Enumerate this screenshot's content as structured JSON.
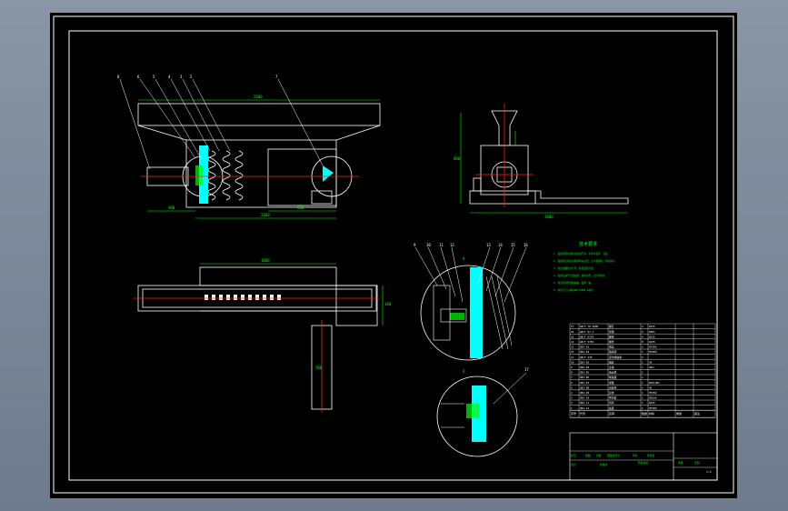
{
  "colors": {
    "background": "#000000",
    "frame": "#ffffff",
    "centerline": "#ff2020",
    "highlight": "#00ffff",
    "dimension": "#00ff00",
    "outline": "#ffffff"
  },
  "main_view": {
    "part_callouts": [
      "8",
      "6",
      "5",
      "4",
      "3",
      "2",
      "7"
    ],
    "dim_top": "2280",
    "dim_bottom_left": "480",
    "dim_bottom_mid": "2260",
    "dim_bottom_right": "600"
  },
  "plan_view": {
    "dim_top": "1000",
    "dim_right": "140",
    "dim_column": "780"
  },
  "side_view": {
    "dim_left": "800",
    "dim_bottom": "1800"
  },
  "detail_view": {
    "callouts": [
      "9",
      "10",
      "11",
      "12",
      "13",
      "14",
      "15",
      "16"
    ],
    "section_label_top": "A",
    "section_label_bottom": "A",
    "lower_callout": "17"
  },
  "tech_notes": {
    "title": "技术要求",
    "lines": [
      "1. 装配前所有零件应清洗干净，不得有毛刺、飞边。",
      "2. 装配时应保证各轴承转动灵活，无卡滞现象，润滑良好。",
      "3. 各连接螺栓应拧紧，防松装置可靠。",
      "4. 装配后进行空载试验，运转平稳，无异常噪音。",
      "5. 外表面涂防锈漆两遍，面漆一遍。",
      "6. 未注尺寸公差按GB/T1804-m执行。"
    ]
  },
  "parts_table": {
    "columns": [
      "序号",
      "代号",
      "名称",
      "数量",
      "材料",
      "重量",
      "备注"
    ],
    "rows": [
      [
        "17",
        "GB/T 70-2000",
        "螺钉",
        "4",
        "Q235",
        "",
        ""
      ],
      [
        "16",
        "GB/T 97.1",
        "垫圈",
        "4",
        "65Mn",
        "",
        ""
      ],
      [
        "15",
        "GB/T 6170",
        "螺母",
        "4",
        "Q235",
        "",
        ""
      ],
      [
        "14",
        "GB/T 5783",
        "螺栓",
        "8",
        "Q235",
        "",
        ""
      ],
      [
        "13",
        "ZBJ-01",
        "端盖",
        "1",
        "HT200",
        "",
        ""
      ],
      [
        "12",
        "ZBJ-02",
        "轴承座",
        "1",
        "HT200",
        "",
        ""
      ],
      [
        "11",
        "GB/T 276",
        "深沟球轴承",
        "2",
        "",
        "",
        ""
      ],
      [
        "10",
        "ZBJ-03",
        "轴套",
        "1",
        "45",
        "",
        ""
      ],
      [
        "9",
        "ZBJ-04",
        "主轴",
        "1",
        "40Cr",
        "",
        ""
      ],
      [
        "8",
        "ZBJ-05",
        "电动机",
        "1",
        "",
        "",
        ""
      ],
      [
        "7",
        "ZBJ-06",
        "联轴器",
        "1",
        "",
        "",
        ""
      ],
      [
        "6",
        "ZBJ-07",
        "弹簧",
        "1",
        "60Si2Mn",
        "",
        ""
      ],
      [
        "5",
        "ZBJ-08",
        "活塞杆",
        "1",
        "45",
        "",
        ""
      ],
      [
        "4",
        "ZBJ-09",
        "缸体",
        "1",
        "HT250",
        "",
        ""
      ],
      [
        "3",
        "ZBJ-10",
        "导向套",
        "1",
        "ZQSn6",
        "",
        ""
      ],
      [
        "2",
        "ZBJ-11",
        "机架",
        "1",
        "Q235",
        "",
        ""
      ],
      [
        "1",
        "ZBJ-12",
        "底座",
        "1",
        "HT200",
        "",
        ""
      ]
    ]
  },
  "title_block": {
    "row_a": [
      "标记",
      "处数",
      "分区",
      "更改文件号",
      "签名",
      "年月日"
    ],
    "row_b": [
      "设计",
      "",
      "标准化",
      "",
      "阶段标记",
      "重量",
      "比例"
    ],
    "scale": "1:5"
  }
}
